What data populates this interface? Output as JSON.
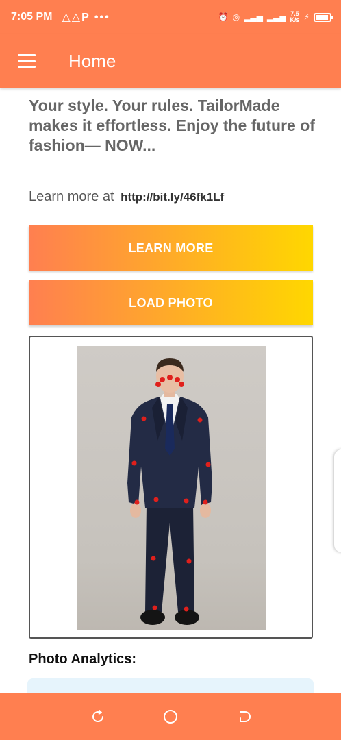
{
  "status_bar": {
    "time": "7:05 PM",
    "notification_icons": "△△P •••",
    "network_speed": "7.5",
    "network_speed_unit": "K/s",
    "battery_level": 0.9
  },
  "app_bar": {
    "title": "Home",
    "menu_icon": "hamburger-menu-icon",
    "background_color": "#ff7f50"
  },
  "main": {
    "tagline": "Your style. Your rules. TailorMade makes it effortless. Enjoy the future of fashion— NOW...",
    "learn_more_prefix": "Learn more at",
    "learn_more_url": "http://bit.ly/46fk1Lf",
    "buttons": {
      "learn_more": "LEARN MORE",
      "load_photo": "LOAD PHOTO"
    },
    "photo": {
      "subject": "man in navy suit with pose keypoints",
      "keypoint_color": "#e0201c"
    },
    "analytics": {
      "title": "Photo Analytics:"
    }
  },
  "nav_bar": {
    "buttons": [
      "recent-apps-icon",
      "home-icon",
      "back-icon"
    ]
  },
  "colors": {
    "accent": "#ff7f50",
    "gradient_end": "#ffd700",
    "analytics_card": "#e6f4fc"
  }
}
